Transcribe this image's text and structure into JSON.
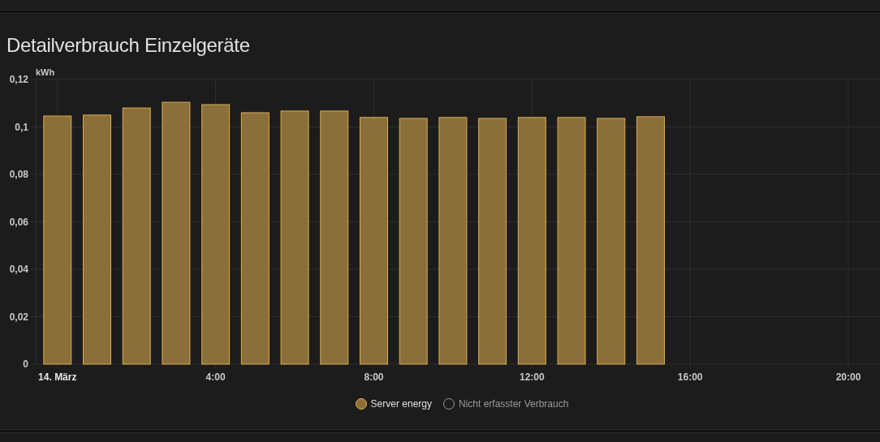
{
  "card": {
    "title": "Detailverbrauch Einzelgeräte"
  },
  "chart_data": {
    "type": "bar",
    "ylabel": "kWh",
    "x": [
      0,
      1,
      2,
      3,
      4,
      5,
      6,
      7,
      8,
      9,
      10,
      11,
      12,
      13,
      14,
      15
    ],
    "grid": true,
    "series": [
      {
        "name": "Server energy",
        "color": "#8b6f3a",
        "values": [
          0.1046,
          0.105,
          0.108,
          0.1104,
          0.1094,
          0.106,
          0.1067,
          0.1067,
          0.104,
          0.1036,
          0.104,
          0.1036,
          0.104,
          0.104,
          0.1036,
          0.1043
        ]
      },
      {
        "name": "Nicht erfasster Verbrauch",
        "values": [
          null,
          null,
          null,
          null,
          null,
          null,
          null,
          null,
          null,
          null,
          null,
          null,
          null,
          null,
          null,
          null
        ]
      }
    ],
    "xlim": [
      -0.55,
      20.8
    ],
    "ylim": [
      0,
      0.12
    ],
    "annotations": [
      {
        "x": 0,
        "text": "14. März"
      }
    ],
    "xticks": [
      {
        "value": 4,
        "label": "4:00"
      },
      {
        "value": 8,
        "label": "8:00"
      },
      {
        "value": 12,
        "label": "12:00"
      },
      {
        "value": 16,
        "label": "16:00"
      },
      {
        "value": 20,
        "label": "20:00"
      }
    ],
    "yticks": [
      {
        "value": 0,
        "label": "0"
      },
      {
        "value": 0.02,
        "label": "0,02"
      },
      {
        "value": 0.04,
        "label": "0,04"
      },
      {
        "value": 0.06,
        "label": "0,06"
      },
      {
        "value": 0.08,
        "label": "0,08"
      },
      {
        "value": 0.1,
        "label": "0,1"
      },
      {
        "value": 0.12,
        "label": "0,12"
      }
    ]
  },
  "legend": [
    {
      "hidden": false
    },
    {
      "hidden": true
    }
  ]
}
